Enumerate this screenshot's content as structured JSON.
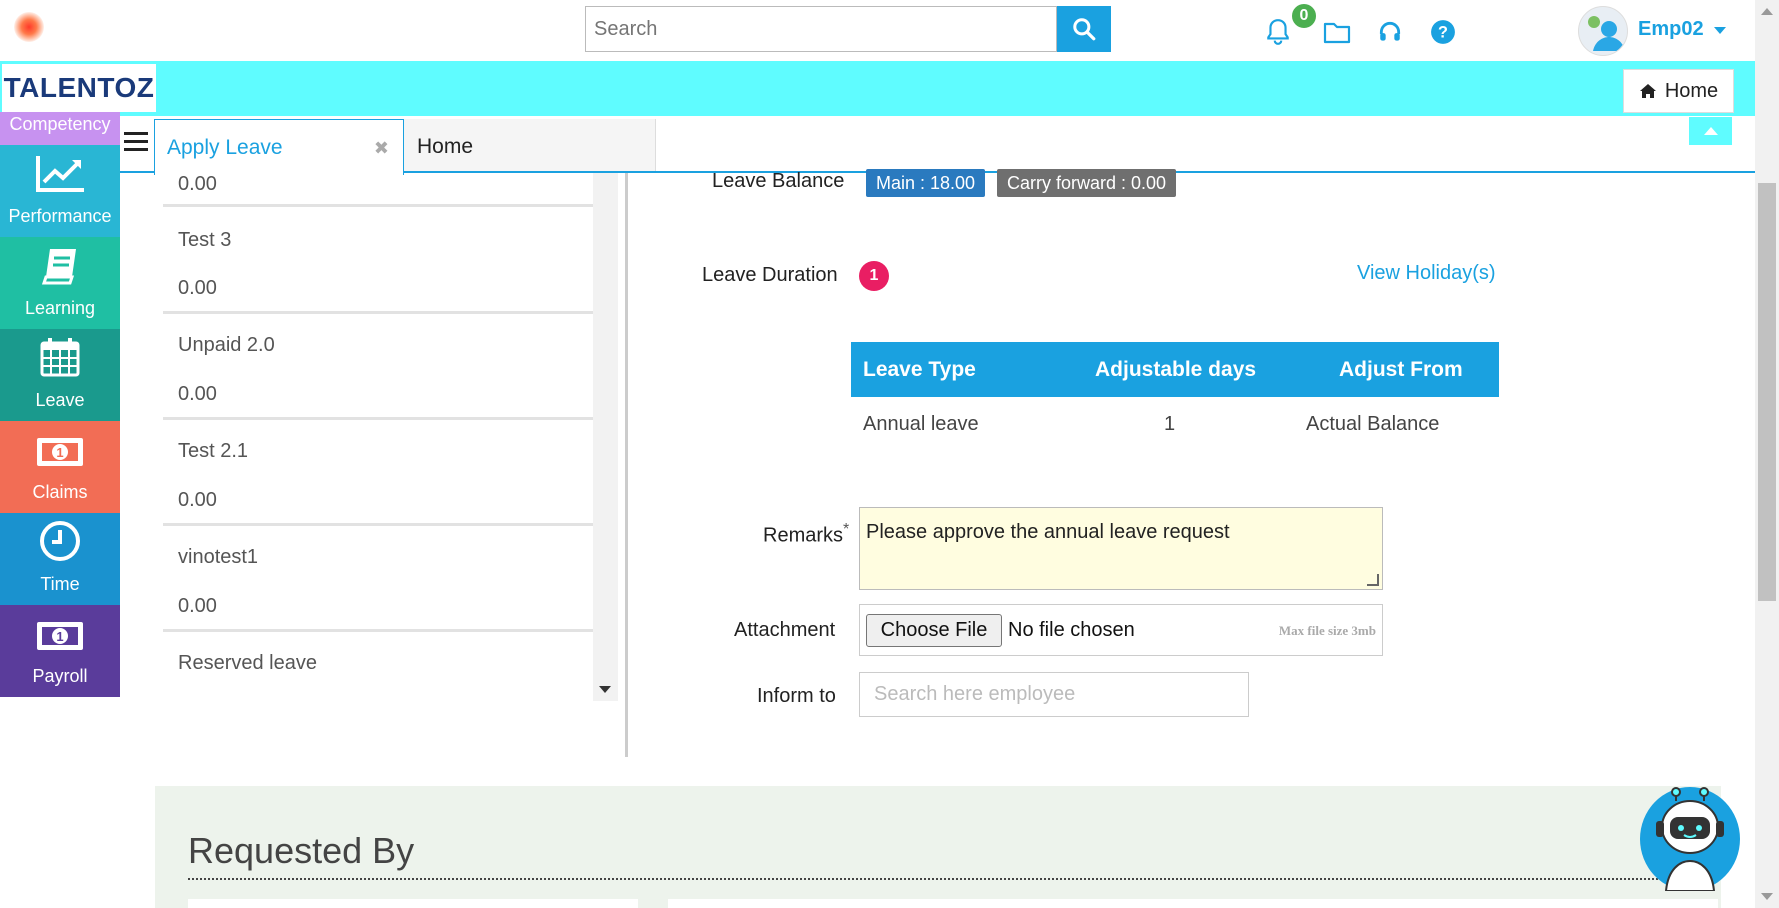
{
  "header": {
    "search_placeholder": "Search",
    "notification_count": "0",
    "user_name": "Emp02"
  },
  "brand": {
    "logo_text": "TALENTOZ",
    "home_label": "Home"
  },
  "sidebar": {
    "items": [
      {
        "label": "Competency",
        "icon": "competency-icon",
        "color": "#c792f0"
      },
      {
        "label": "Performance",
        "icon": "performance-chart-icon",
        "color": "#29b6d4"
      },
      {
        "label": "Learning",
        "icon": "book-icon",
        "color": "#1fbfa3"
      },
      {
        "label": "Leave",
        "icon": "calendar-icon",
        "color": "#1a9a8d"
      },
      {
        "label": "Claims",
        "icon": "money-icon",
        "color": "#f26d55"
      },
      {
        "label": "Time",
        "icon": "clock-icon",
        "color": "#1a92cf"
      },
      {
        "label": "Payroll",
        "icon": "money-icon",
        "color": "#5a3c9b"
      }
    ]
  },
  "tabs": {
    "active": "Apply Leave",
    "second": "Home"
  },
  "leave_list": [
    {
      "name": "",
      "value": "0.00"
    },
    {
      "name": "Test 3",
      "value": "0.00"
    },
    {
      "name": "Unpaid 2.0",
      "value": "0.00"
    },
    {
      "name": "Test 2.1",
      "value": "0.00"
    },
    {
      "name": "vinotest1",
      "value": "0.00"
    },
    {
      "name": "Reserved leave",
      "value": ""
    }
  ],
  "form": {
    "balance_label": "Leave Balance",
    "balance_main": "Main : 18.00",
    "balance_carry": "Carry forward : 0.00",
    "duration_label": "Leave Duration",
    "duration_count": "1",
    "view_holidays": "View Holiday(s)",
    "table": {
      "headers": [
        "Leave Type",
        "Adjustable days",
        "Adjust From"
      ],
      "rows": [
        [
          "Annual leave",
          "1",
          "Actual Balance"
        ]
      ]
    },
    "remarks_label": "Remarks",
    "remarks_required": "*",
    "remarks_value": "Please approve the annual leave request",
    "attachment_label": "Attachment",
    "choose_file": "Choose File",
    "no_file": "No file chosen",
    "max_size": "Max file size 3mb",
    "inform_label": "Inform to",
    "inform_placeholder": "Search here employee"
  },
  "requested_by": {
    "title": "Requested By"
  },
  "colors": {
    "accent": "#1aa1e0",
    "cyan_band": "#5ffcff",
    "required_badge": "#e91e63",
    "remarks_bg": "#fffde0"
  }
}
